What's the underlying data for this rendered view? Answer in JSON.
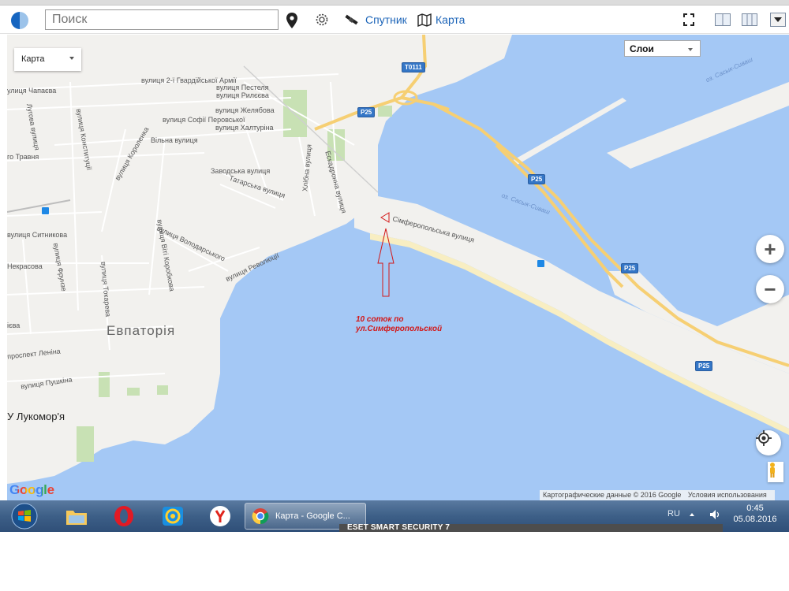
{
  "toolbar": {
    "search_placeholder": "Поиск",
    "satellite_label": "Спутник",
    "map_label": "Карта"
  },
  "map": {
    "map_type_value": "Карта",
    "layers_value": "Слои",
    "zoom_in": "+",
    "zoom_out": "−",
    "google_logo": "Google",
    "attribution_data": "Картографические данные © 2016 Google",
    "attribution_terms": "Условия использования",
    "annotation_line1": "10 соток по",
    "annotation_line2": "ул.Симферопольской",
    "labels": {
      "city": "Евпаторія",
      "chapaeva": "улиця Чапаєва",
      "gvardiiskoi": "вулиця 2-ї Гвардійської Армії",
      "pestelia": "вулиця Пестеля",
      "ryleieva": "вулиця Рилєєва",
      "zheliabova": "вулиця Желябова",
      "perovskoi": "вулиця Софії Перовської",
      "khalturina": "вулиця Халтуріна",
      "vilna": "Вільна вулиця",
      "zavodska": "Заводська вулиця",
      "tatarska": "Татарська вулиця",
      "khlibna": "Хлібна вулиця",
      "eskadronna": "Ескадронна вулиця",
      "simferopolska": "Сімферопольська вулиця",
      "sytnykova": "вулиця Ситникова",
      "nekrasova": "Некрасова",
      "frunze": "вулиця Фрунзе",
      "tokareva": "вулиця Токарева",
      "volodarskoho": "вулиця Володарського",
      "revoliutsii": "вулиця Революції",
      "vitikorobkova": "вулиця Віті Коробкова",
      "lenina": "проспект Леніна",
      "pushkina": "вулиця Пушкіна",
      "lukomorya": "У Лукомор'я",
      "korolenka": "вулиця Короленка",
      "konstytutsii": "вулиця Конституції",
      "luhova": "Лугова вулиця",
      "travnia": "го Травня",
      "lieva": "ієва",
      "sasyk1": "оз. Сасык-Сиваш",
      "sasyk2": "оз. Сасык-Сиваш",
      "t0111": "T0111",
      "p25": "P25"
    }
  },
  "taskbar": {
    "chrome_task_label": "Карта - Google C...",
    "eset": "ESET SMART SECURITY 7",
    "lang": "RU",
    "time": "0:45",
    "date": "05.08.2016"
  },
  "colors": {
    "water": "#a4c8f5",
    "land": "#f2f1ee",
    "park": "#c8e1b4",
    "beach": "#f8eec2",
    "highway": "#f6cf73",
    "accent": "#1c64b8",
    "annotation": "#d31717"
  }
}
